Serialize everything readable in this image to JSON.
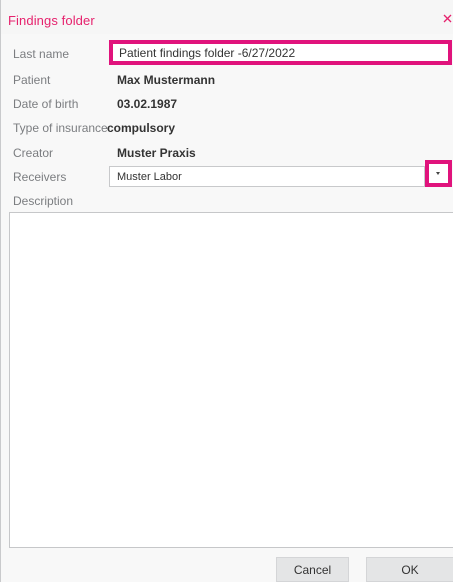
{
  "dialog": {
    "title": "Findings folder",
    "close_icon": "close-icon"
  },
  "form": {
    "last_name": {
      "label": "Last name",
      "value": "Patient findings folder -6/27/2022"
    },
    "patient": {
      "label": "Patient",
      "value": "Max Mustermann"
    },
    "date_of_birth": {
      "label": "Date of birth",
      "value": "03.02.1987"
    },
    "type_of_insurance": {
      "label": "Type of insurance",
      "value": "compulsory"
    },
    "creator": {
      "label": "Creator",
      "value": "Muster Praxis"
    },
    "receivers": {
      "label": "Receivers",
      "selected": "Muster Labor",
      "icon": "chevron-down-icon"
    },
    "description": {
      "label": "Description",
      "value": ""
    }
  },
  "buttons": {
    "cancel": "Cancel",
    "ok": "OK"
  },
  "colors": {
    "accent": "#e0137c",
    "title_text": "#e6226d",
    "label_text": "#7b7d80",
    "value_text": "#333333"
  }
}
